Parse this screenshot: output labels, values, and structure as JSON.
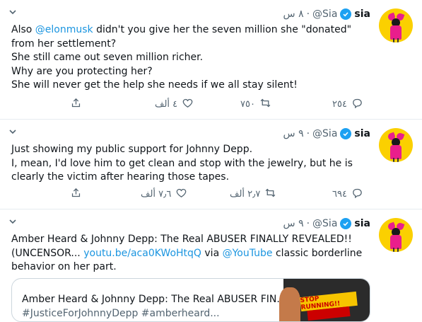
{
  "tweets": [
    {
      "name": "sia",
      "handle": "@Sia",
      "dot": "·",
      "time": "٨ س",
      "text": {
        "p1_prefix": "Also ",
        "p1_mention": "@elonmusk",
        "p1_rest": " didn't you give her the seven million she \"donated\" from her settlement?",
        "p2": "She still came out seven million richer.",
        "p3": "Why are you protecting her?",
        "p4": "She will never get the help she needs if we all stay silent!"
      },
      "stats": {
        "replies": "٢٥٤",
        "retweets": "٧٥٠",
        "likes": "٤ ألف"
      }
    },
    {
      "name": "sia",
      "handle": "@Sia",
      "dot": "·",
      "time": "٩ س",
      "text": {
        "p1": "Just showing my public support for Johnny Depp.",
        "p2": "I, mean, I'd love him to get clean and stop with the jewelry, but he is clearly the victim after hearing those tapes."
      },
      "stats": {
        "replies": "٦٩٤",
        "retweets": "٢٫٧ ألف",
        "likes": "٧٫٦ ألف"
      }
    },
    {
      "name": "sia",
      "handle": "@Sia",
      "dot": "·",
      "time": "٩ س",
      "text": {
        "p1_prefix": "Amber Heard & Johnny Depp:  The Real ABUSER FINALLY REVEALED!! (UNCENSOR... ",
        "p1_link": "youtu.be/aca0KWoHtqQ",
        "p1_mid": " via ",
        "p1_mention": "@YouTube",
        "p1_rest": " classic borderline behavior on her part."
      },
      "card": {
        "title": "Amber Heard & Johnny Depp: The Real ABUSER FIN...",
        "subtitle": "#JusticeForJohnnyDepp #amberheard...",
        "thumb_text": "STOP RUNNING!!"
      }
    }
  ],
  "icons": {
    "more": "chevron-down-icon",
    "reply": "reply-icon",
    "retweet": "retweet-icon",
    "like": "heart-icon",
    "share": "share-icon",
    "verified": "verified-badge-icon"
  },
  "colors": {
    "link": "#1b95e0",
    "verified": "#1da1f2",
    "muted": "#536471",
    "avatar_bg": "#fbd000",
    "avatar_dress": "#e91e8c"
  }
}
